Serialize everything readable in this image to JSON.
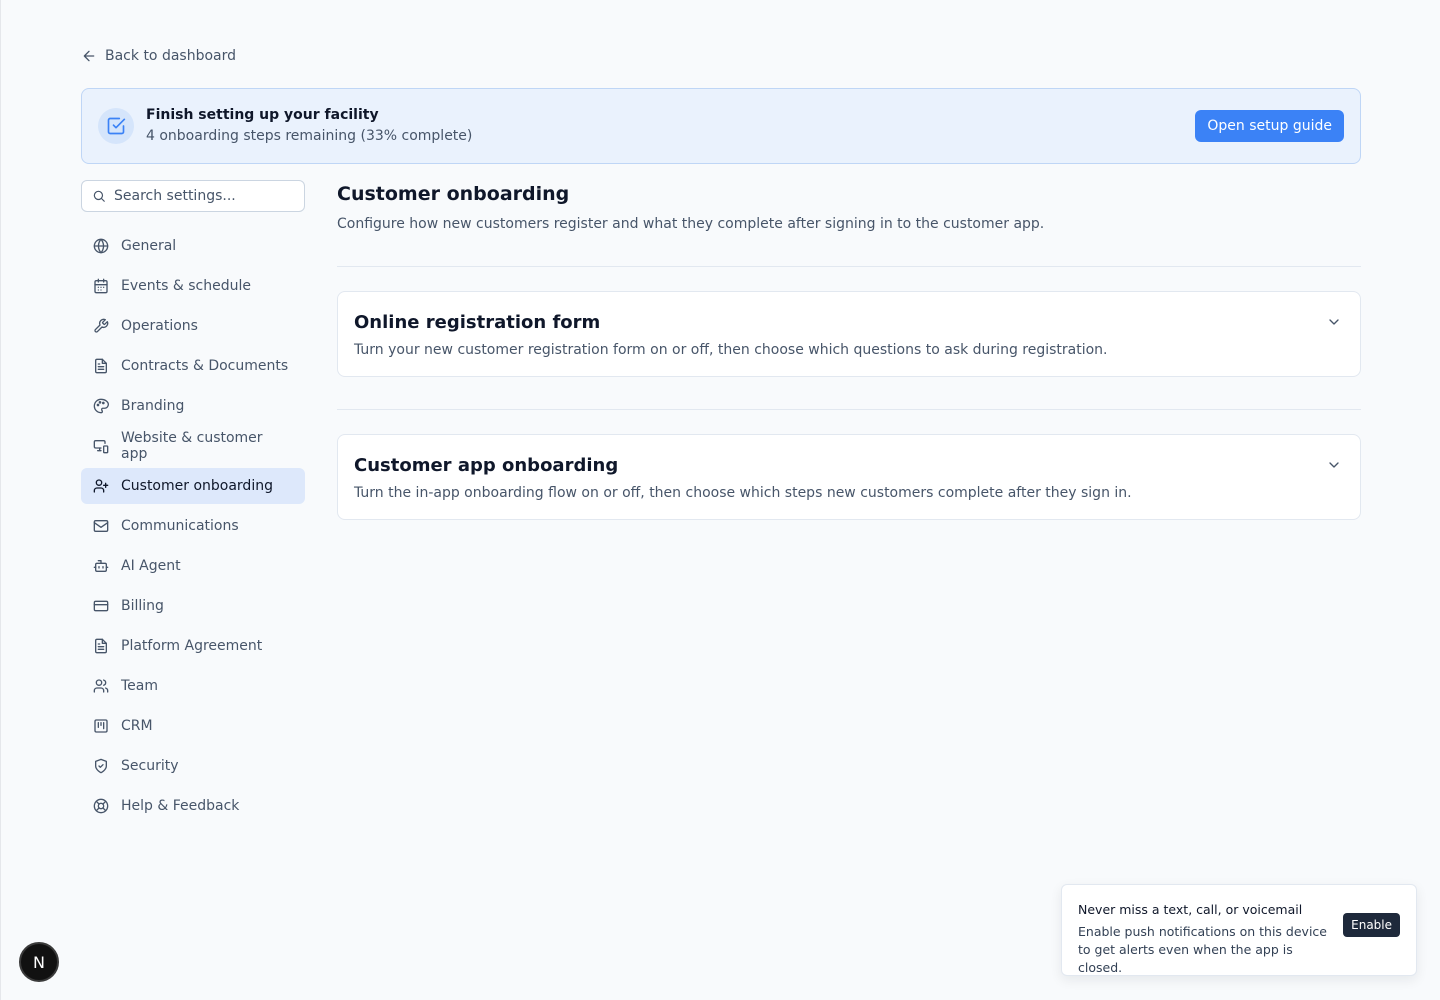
{
  "back_link": {
    "label": "Back to dashboard",
    "icon": "arrow-left-icon"
  },
  "setup_banner": {
    "icon": "square-check-icon",
    "title": "Finish setting up your facility",
    "subtitle": "4 onboarding steps remaining (33% complete)",
    "button_label": "Open setup guide",
    "progress_percent": 33
  },
  "search": {
    "placeholder": "Search settings...",
    "value": ""
  },
  "sidebar": {
    "items": [
      {
        "label": "General",
        "icon": "globe-icon",
        "active": false
      },
      {
        "label": "Events & schedule",
        "icon": "calendar-icon",
        "active": false
      },
      {
        "label": "Operations",
        "icon": "wrench-icon",
        "active": false
      },
      {
        "label": "Contracts & Documents",
        "icon": "file-text-icon",
        "active": false
      },
      {
        "label": "Branding",
        "icon": "palette-icon",
        "active": false
      },
      {
        "label": "Website & customer app",
        "icon": "devices-icon",
        "active": false
      },
      {
        "label": "Customer onboarding",
        "icon": "user-plus-icon",
        "active": true
      },
      {
        "label": "Communications",
        "icon": "mail-icon",
        "active": false
      },
      {
        "label": "AI Agent",
        "icon": "bot-icon",
        "active": false
      },
      {
        "label": "Billing",
        "icon": "credit-card-icon",
        "active": false
      },
      {
        "label": "Platform Agreement",
        "icon": "file-text-icon",
        "active": false
      },
      {
        "label": "Team",
        "icon": "users-icon",
        "active": false
      },
      {
        "label": "CRM",
        "icon": "kanban-icon",
        "active": false
      },
      {
        "label": "Security",
        "icon": "shield-icon",
        "active": false
      },
      {
        "label": "Help & Feedback",
        "icon": "life-buoy-icon",
        "active": false
      }
    ]
  },
  "main": {
    "title": "Customer onboarding",
    "description": "Configure how new customers register and what they complete after signing in to the customer app.",
    "sections": [
      {
        "title": "Online registration form",
        "description": "Turn your new customer registration form on or off, then choose which questions to ask during registration."
      },
      {
        "title": "Customer app onboarding",
        "description": "Turn the in-app onboarding flow on or off, then choose which steps new customers complete after they sign in."
      }
    ]
  },
  "toast": {
    "title": "Never miss a text, call, or voicemail",
    "body": "Enable push notifications on this device to get alerts even when the app is closed.",
    "button_label": "Enable"
  },
  "avatar": {
    "initial": "N"
  },
  "colors": {
    "accent": "#3b82f6",
    "banner_bg": "#eaf2fd",
    "active_nav_bg": "#dde8fb",
    "page_bg": "#f8fafc"
  }
}
